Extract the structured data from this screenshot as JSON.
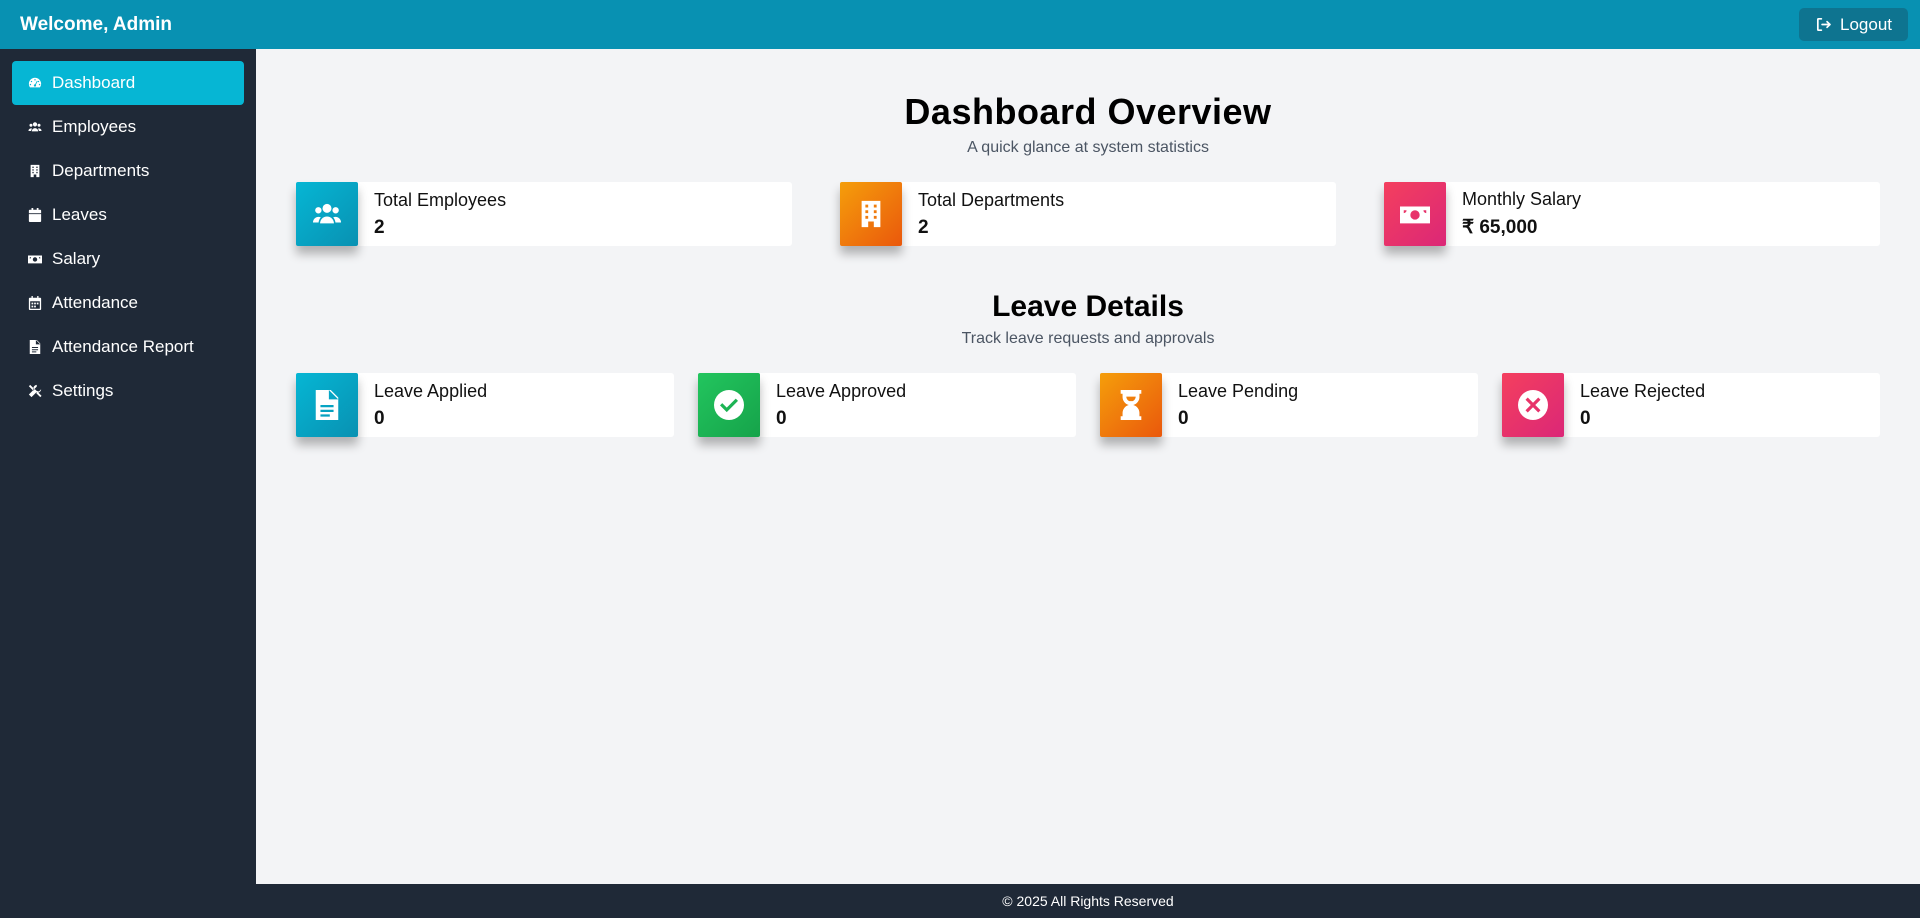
{
  "header": {
    "welcome": "Welcome, Admin",
    "logout_label": "Logout"
  },
  "sidebar": {
    "items": [
      {
        "label": "Dashboard",
        "icon": "dashboard-icon",
        "active": true
      },
      {
        "label": "Employees",
        "icon": "users-icon"
      },
      {
        "label": "Departments",
        "icon": "building-icon"
      },
      {
        "label": "Leaves",
        "icon": "calendar-icon"
      },
      {
        "label": "Salary",
        "icon": "money-icon"
      },
      {
        "label": "Attendance",
        "icon": "calendar-days-icon"
      },
      {
        "label": "Attendance Report",
        "icon": "file-icon"
      },
      {
        "label": "Settings",
        "icon": "tools-icon"
      }
    ]
  },
  "overview": {
    "title": "Dashboard Overview",
    "subtitle": "A quick glance at system statistics",
    "cards": [
      {
        "label": "Total Employees",
        "value": "2",
        "icon": "users-icon",
        "color": "#06b6d4"
      },
      {
        "label": "Total Departments",
        "value": "2",
        "icon": "building-icon",
        "color": "#f59e0b"
      },
      {
        "label": "Monthly Salary",
        "value": "₹ 65,000",
        "icon": "money-icon",
        "color": "#f43f5e"
      }
    ]
  },
  "leave": {
    "title": "Leave Details",
    "subtitle": "Track leave requests and approvals",
    "cards": [
      {
        "label": "Leave Applied",
        "value": "0",
        "icon": "file-icon",
        "color": "#06b6d4"
      },
      {
        "label": "Leave Approved",
        "value": "0",
        "icon": "check-circle-icon",
        "color": "#22c55e"
      },
      {
        "label": "Leave Pending",
        "value": "0",
        "icon": "hourglass-icon",
        "color": "#f59e0b"
      },
      {
        "label": "Leave Rejected",
        "value": "0",
        "icon": "x-circle-icon",
        "color": "#f43f5e"
      }
    ]
  },
  "footer": {
    "text": "© 2025 All Rights Reserved"
  }
}
